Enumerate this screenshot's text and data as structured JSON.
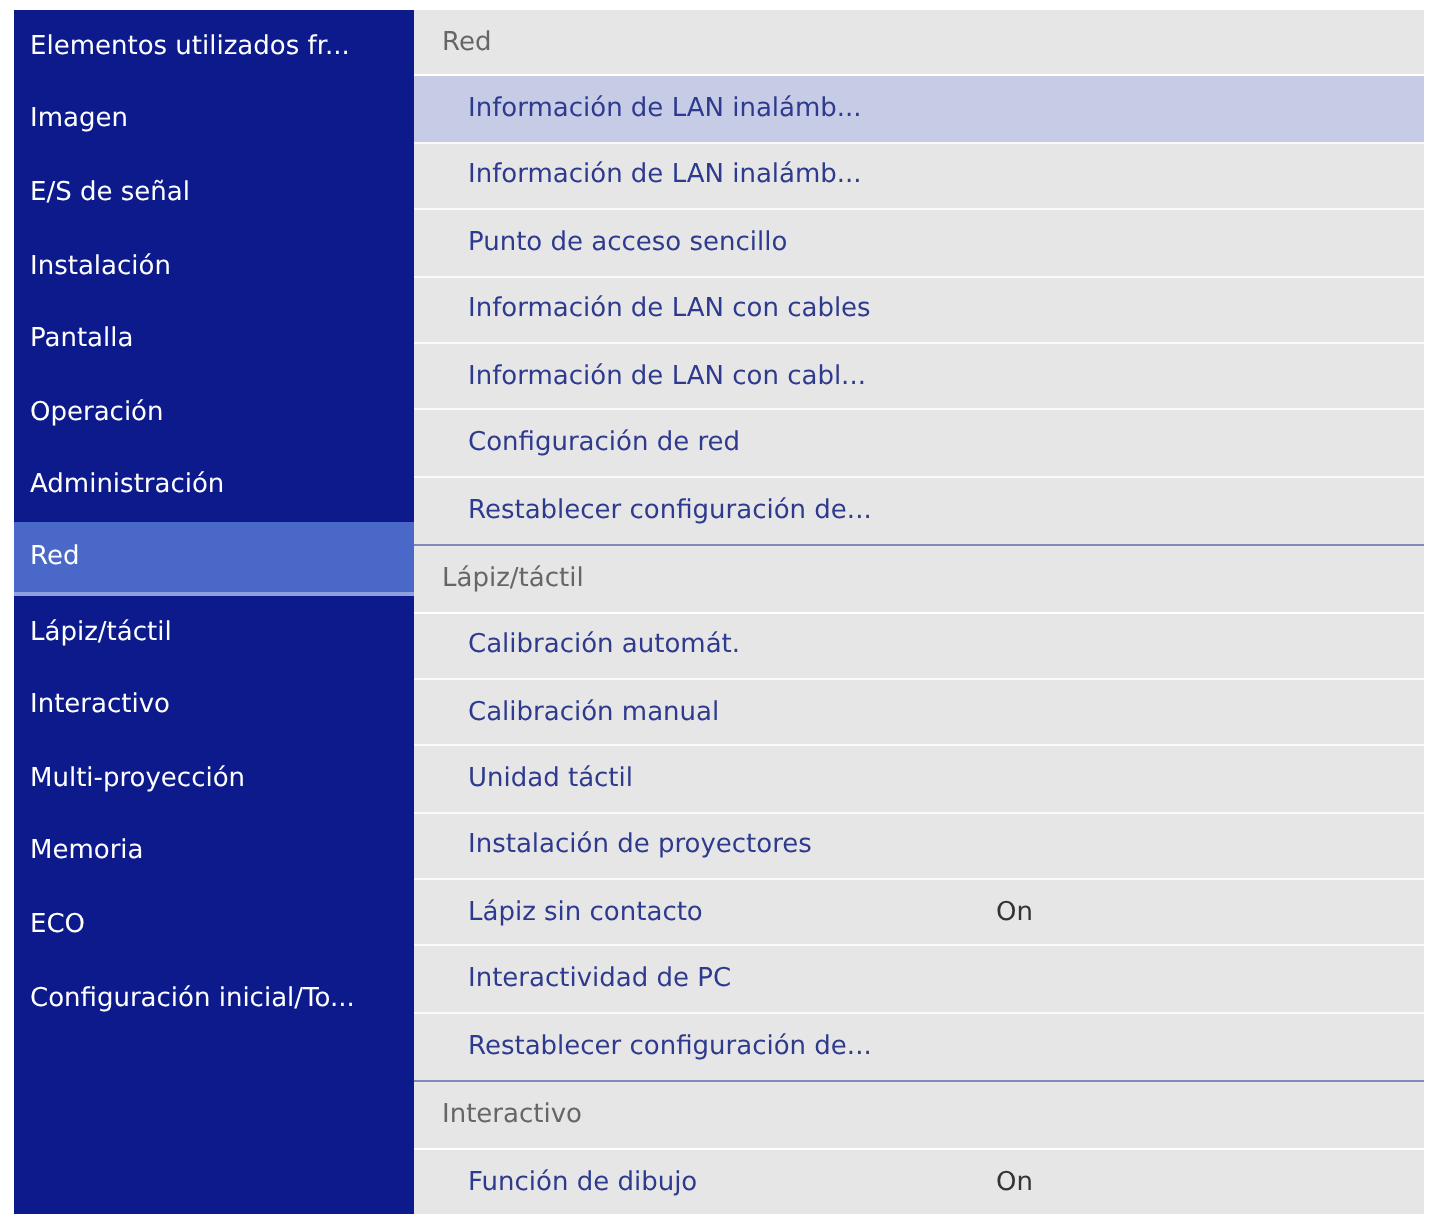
{
  "sidebar": {
    "items": [
      {
        "label": "Elementos utilizados fr...",
        "selected": false
      },
      {
        "label": "Imagen",
        "selected": false
      },
      {
        "label": "E/S de señal",
        "selected": false
      },
      {
        "label": "Instalación",
        "selected": false
      },
      {
        "label": "Pantalla",
        "selected": false
      },
      {
        "label": "Operación",
        "selected": false
      },
      {
        "label": "Administración",
        "selected": false
      },
      {
        "label": "Red",
        "selected": true
      },
      {
        "label": "Lápiz/táctil",
        "selected": false
      },
      {
        "label": "Interactivo",
        "selected": false
      },
      {
        "label": "Multi-proyección",
        "selected": false
      },
      {
        "label": "Memoria",
        "selected": false
      },
      {
        "label": "ECO",
        "selected": false
      },
      {
        "label": "Configuración inicial/To...",
        "selected": false
      }
    ]
  },
  "sections": [
    {
      "title": "Red",
      "items": [
        {
          "label": "Información de LAN inalámb...",
          "selected": true
        },
        {
          "label": "Información de LAN inalámb...",
          "selected": false
        },
        {
          "label": "Punto de acceso sencillo",
          "selected": false
        },
        {
          "label": "Información de LAN con cables",
          "selected": false
        },
        {
          "label": "Información de LAN con cabl...",
          "selected": false
        },
        {
          "label": "Configuración de red",
          "selected": false
        },
        {
          "label": "Restablecer configuración de...",
          "selected": false
        }
      ]
    },
    {
      "title": "Lápiz/táctil",
      "items": [
        {
          "label": "Calibración automát.",
          "selected": false
        },
        {
          "label": "Calibración manual",
          "selected": false
        },
        {
          "label": "Unidad táctil",
          "selected": false
        },
        {
          "label": "Instalación de proyectores",
          "selected": false
        },
        {
          "label": "Lápiz sin contacto",
          "selected": false,
          "value": "On"
        },
        {
          "label": "Interactividad de PC",
          "selected": false
        },
        {
          "label": "Restablecer configuración de...",
          "selected": false
        }
      ]
    },
    {
      "title": "Interactivo",
      "items": [
        {
          "label": "Función de dibujo",
          "selected": false,
          "value": "On"
        }
      ]
    }
  ]
}
